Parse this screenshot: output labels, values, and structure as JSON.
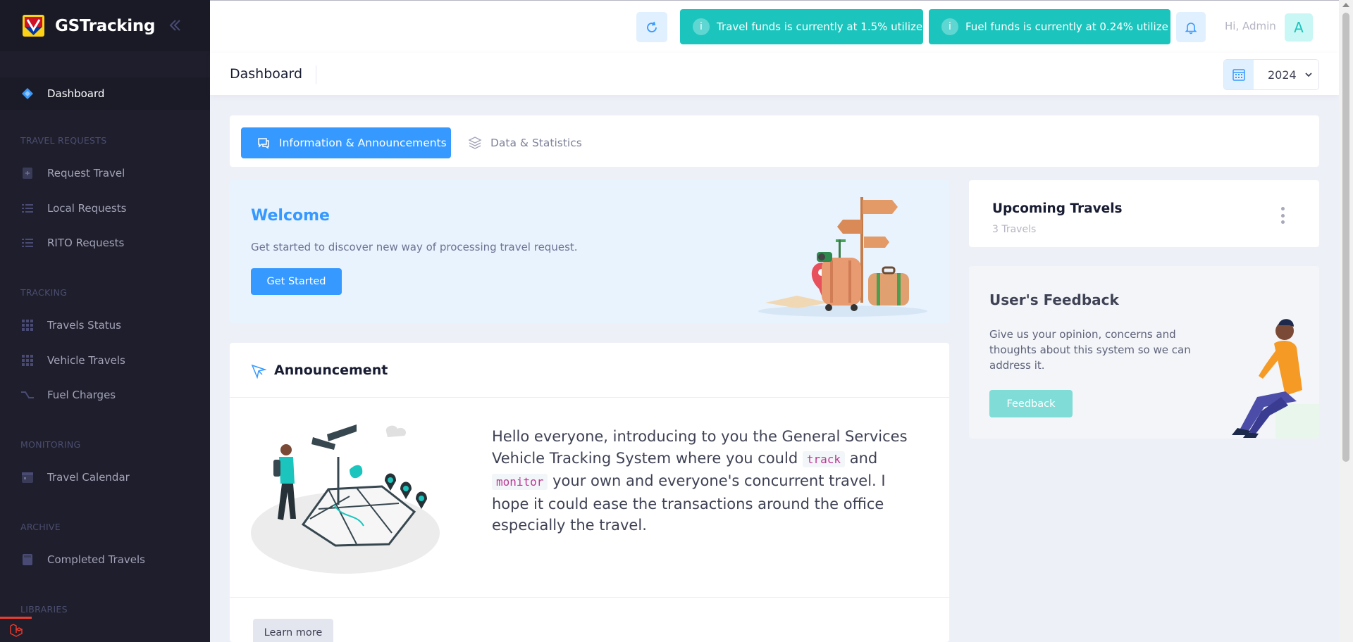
{
  "app": {
    "name": "GSTracking"
  },
  "sidebar": {
    "active": {
      "label": "Dashboard",
      "icon": "diamond-icon"
    },
    "sections": [
      {
        "title": "TRAVEL REQUESTS",
        "items": [
          {
            "label": "Request Travel",
            "icon": "plus-file-icon"
          },
          {
            "label": "Local Requests",
            "icon": "list-icon"
          },
          {
            "label": "RITO Requests",
            "icon": "list-icon"
          }
        ]
      },
      {
        "title": "TRACKING",
        "items": [
          {
            "label": "Travels Status",
            "icon": "grid-icon"
          },
          {
            "label": "Vehicle Travels",
            "icon": "grid-icon"
          },
          {
            "label": "Fuel Charges",
            "icon": "route-icon"
          }
        ]
      },
      {
        "title": "MONITORING",
        "items": [
          {
            "label": "Travel Calendar",
            "icon": "calendar-icon"
          }
        ]
      },
      {
        "title": "ARCHIVE",
        "items": [
          {
            "label": "Completed Travels",
            "icon": "book-icon"
          }
        ]
      },
      {
        "title": "LIBRARIES",
        "items": []
      }
    ]
  },
  "header": {
    "travel_funds": "Travel funds is currently at 1.5% utilize",
    "fuel_funds": "Fuel funds is currently at 0.24% utilize",
    "greeting": "Hi, Admin",
    "avatar_initial": "A",
    "info_symbol": "i"
  },
  "subheader": {
    "title": "Dashboard",
    "year": "2024"
  },
  "tabs": [
    {
      "label": "Information & Announcements",
      "active": true
    },
    {
      "label": "Data & Statistics",
      "active": false
    }
  ],
  "welcome": {
    "title": "Welcome",
    "text": "Get started to discover new way of processing travel request.",
    "button": "Get Started"
  },
  "upcoming": {
    "title": "Upcoming Travels",
    "subtitle": "3 Travels"
  },
  "feedback": {
    "title": "User's Feedback",
    "text": "Give us your opinion, concerns and thoughts about this system so we can address it.",
    "button": "Feedback"
  },
  "announcement": {
    "title": "Announcement",
    "text_1": "Hello everyone, introducing to you the General Services Vehicle Tracking System where you could",
    "code_1": "track",
    "text_2": "and",
    "code_2": "monitor",
    "text_3": "your own and everyone's concurrent travel. I hope it could ease the transactions around the office especially the travel.",
    "button": "Learn more"
  },
  "colors": {
    "primary": "#3699ff",
    "teal": "#1bc5bd",
    "sidebar": "#1e1e2d"
  }
}
